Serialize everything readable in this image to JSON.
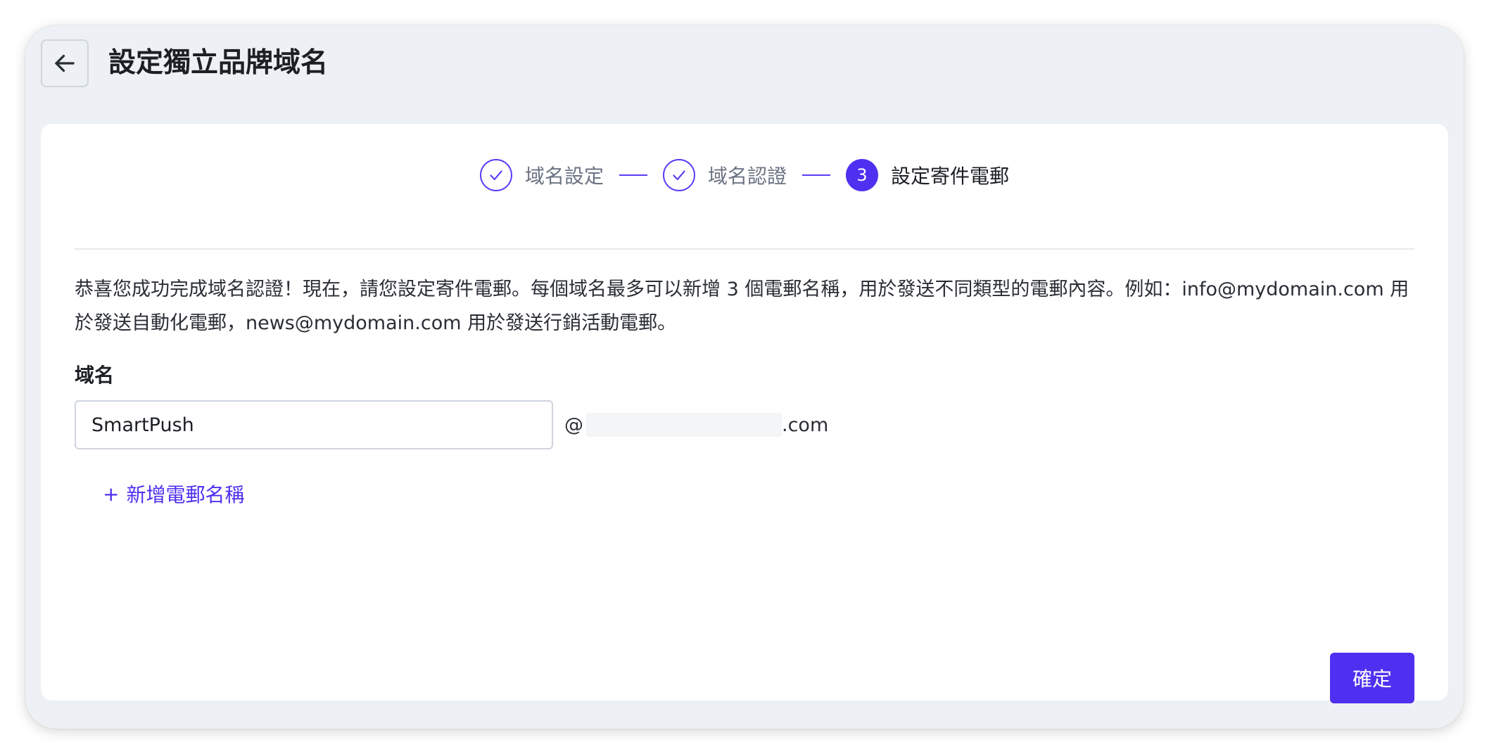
{
  "header": {
    "title": "設定獨立品牌域名"
  },
  "stepper": {
    "steps": [
      {
        "label": "域名設定",
        "status": "done"
      },
      {
        "label": "域名認證",
        "status": "done"
      },
      {
        "label": "設定寄件電郵",
        "status": "active",
        "number": "3"
      }
    ]
  },
  "main": {
    "description": "恭喜您成功完成域名認證！現在，請您設定寄件電郵。每個域名最多可以新增 3 個電郵名稱，用於發送不同類型的電郵內容。例如：info@mydomain.com 用於發送自動化電郵，news@mydomain.com 用於發送行銷活動電郵。",
    "field_label": "域名",
    "email_name_value": "SmartPush",
    "domain_at": "@",
    "domain_visible_suffix": ".com",
    "add_link_plus": "+",
    "add_link_label": "新增電郵名稱",
    "confirm_label": "確定"
  },
  "colors": {
    "accent": "#4f2ff0",
    "background": "#edf0f4",
    "card": "#ffffff"
  },
  "icons": {
    "back": "arrow-left-icon",
    "step_done": "check-icon"
  }
}
